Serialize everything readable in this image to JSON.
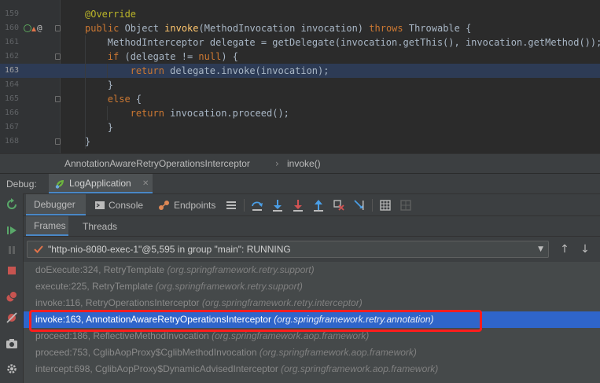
{
  "editor": {
    "lines": [
      {
        "num": "159",
        "tokens": [
          [
            "ann",
            "@Override"
          ]
        ],
        "indent": 4
      },
      {
        "num": "160",
        "tokens": [
          [
            "kw",
            "public "
          ],
          [
            "txt",
            "Object "
          ],
          [
            "fn",
            "invoke"
          ],
          [
            "txt",
            "(MethodInvocation invocation) "
          ],
          [
            "kw",
            "throws "
          ],
          [
            "txt",
            "Throwable {"
          ]
        ],
        "indent": 4
      },
      {
        "num": "161",
        "tokens": [
          [
            "txt",
            "MethodInterceptor delegate = getDelegate(invocation.getThis(), invocation.getMethod());"
          ]
        ],
        "indent": 8
      },
      {
        "num": "162",
        "tokens": [
          [
            "kw",
            "if "
          ],
          [
            "txt",
            "(delegate != "
          ],
          [
            "kw",
            "null"
          ],
          [
            "txt",
            ") {"
          ]
        ],
        "indent": 8
      },
      {
        "num": "163",
        "tokens": [
          [
            "kw",
            "return "
          ],
          [
            "txt",
            "delegate.invoke(invocation);"
          ]
        ],
        "indent": 12
      },
      {
        "num": "164",
        "tokens": [
          [
            "txt",
            "}"
          ]
        ],
        "indent": 8
      },
      {
        "num": "165",
        "tokens": [
          [
            "kw",
            "else "
          ],
          [
            "txt",
            "{"
          ]
        ],
        "indent": 8
      },
      {
        "num": "166",
        "tokens": [
          [
            "kw",
            "return "
          ],
          [
            "txt",
            "invocation.proceed();"
          ]
        ],
        "indent": 12
      },
      {
        "num": "167",
        "tokens": [
          [
            "txt",
            "}"
          ]
        ],
        "indent": 8
      },
      {
        "num": "168",
        "tokens": [
          [
            "txt",
            "}"
          ]
        ],
        "indent": 4
      }
    ],
    "gutter_at": "@"
  },
  "breadcrumb": {
    "class_name": "AnnotationAwareRetryOperationsInterceptor",
    "separator": "›",
    "method_name": "invoke()"
  },
  "debug": {
    "title": "Debug:",
    "run_tab_label": "LogApplication",
    "run_tab_close": "✕"
  },
  "toolbar": {
    "debugger_label": "Debugger",
    "console_label": "Console",
    "endpoints_label": "Endpoints"
  },
  "subtabs": {
    "frames_label": "Frames",
    "threads_label": "Threads"
  },
  "thread": {
    "selected_value": "\"http-nio-8080-exec-1\"@5,595 in group \"main\": RUNNING"
  },
  "frames": [
    {
      "method": "doExecute:324, RetryTemplate",
      "pkg": "(org.springframework.retry.support)"
    },
    {
      "method": "execute:225, RetryTemplate",
      "pkg": "(org.springframework.retry.support)"
    },
    {
      "method": "invoke:116, RetryOperationsInterceptor",
      "pkg": "(org.springframework.retry.interceptor)"
    },
    {
      "method": "invoke:163, AnnotationAwareRetryOperationsInterceptor",
      "pkg": "(org.springframework.retry.annotation)"
    },
    {
      "method": "proceed:186, ReflectiveMethodInvocation",
      "pkg": "(org.springframework.aop.framework)"
    },
    {
      "method": "proceed:753, CglibAopProxy$CglibMethodInvocation",
      "pkg": "(org.springframework.aop.framework)"
    },
    {
      "method": "intercept:698, CglibAopProxy$DynamicAdvisedInterceptor",
      "pkg": "(org.springframework.aop.framework)"
    }
  ],
  "selected_frame_index": 3,
  "colors": {
    "selection": "#2f65ca",
    "highlight_box": "#ff1d1d",
    "tab_underline": "#4a88c7",
    "keyword": "#cc7832",
    "annotation": "#bbb529",
    "method_decl": "#ffc66d"
  }
}
